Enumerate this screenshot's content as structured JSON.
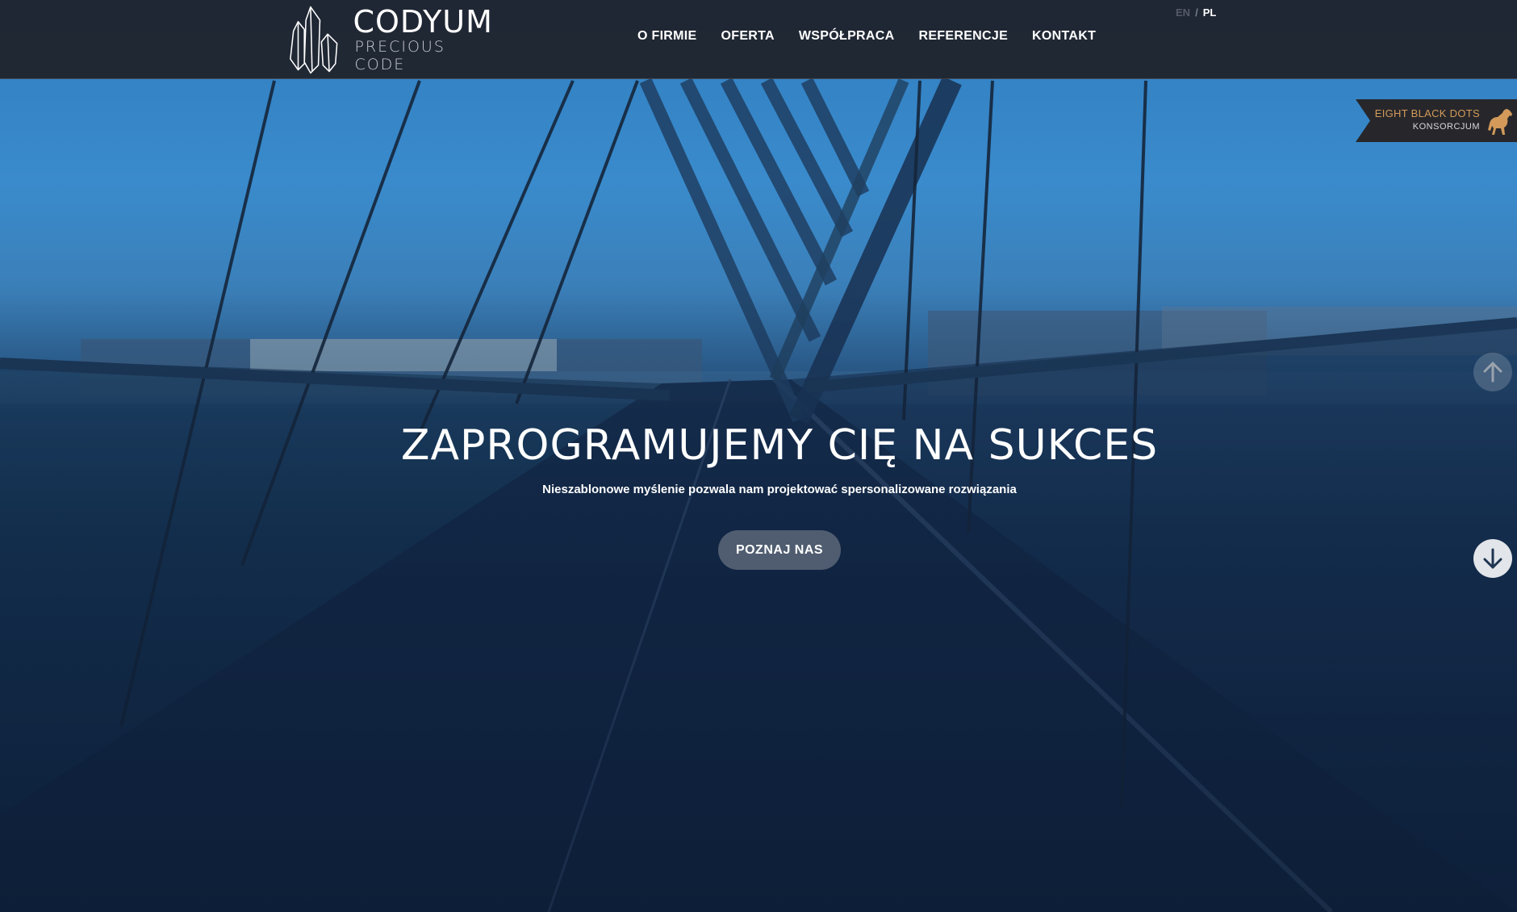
{
  "brand": {
    "name": "CODYUM",
    "tagline": "PRECIOUS CODE"
  },
  "nav": {
    "items": [
      {
        "label": "O FIRMIE"
      },
      {
        "label": "OFERTA"
      },
      {
        "label": "WSPÓŁPRACA"
      },
      {
        "label": "REFERENCJE"
      },
      {
        "label": "KONTAKT"
      }
    ]
  },
  "lang": {
    "en": "EN",
    "separator": "/",
    "pl": "PL",
    "active": "PL"
  },
  "partner": {
    "title": "EIGHT BLACK DOTS",
    "subtitle": "KONSORCJUM",
    "icon": "horse-icon"
  },
  "hero": {
    "title": "ZAPROGRAMUJEMY CIĘ NA SUKCES",
    "subtitle": "Nieszablonowe myślenie pozwala nam projektować spersonalizowane rozwiązania",
    "cta_label": "POZNAJ NAS"
  },
  "controls": {
    "scroll_up_icon": "arrow-up-icon",
    "scroll_down_icon": "arrow-down-icon"
  },
  "colors": {
    "header_bg": "#1f222a",
    "partner_accent": "#d39a5a",
    "cta_bg": "#78808c"
  }
}
